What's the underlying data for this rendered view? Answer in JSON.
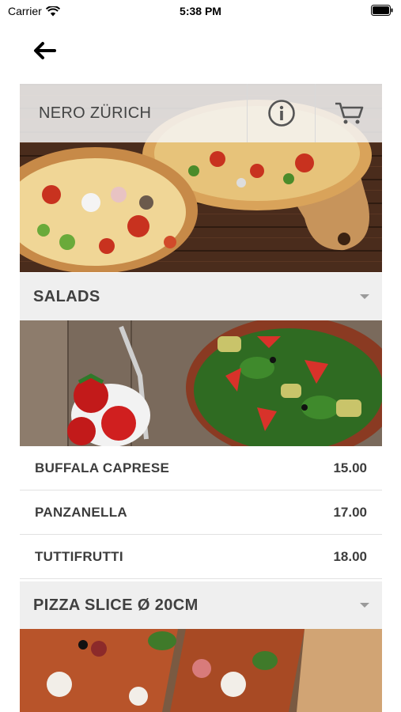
{
  "status": {
    "carrier": "Carrier",
    "time": "5:38 PM"
  },
  "header": {
    "restaurant_name": "NERO ZÜRICH",
    "info_icon": "info-icon",
    "cart_icon": "cart-icon",
    "back_icon": "arrow-left-icon"
  },
  "sections": [
    {
      "title": "SALADS",
      "items": [
        {
          "name": "BUFFALA CAPRESE",
          "price": "15.00"
        },
        {
          "name": "PANZANELLA",
          "price": "17.00"
        },
        {
          "name": "TUTTIFRUTTI",
          "price": "18.00"
        }
      ]
    },
    {
      "title": "PIZZA SLICE Ø 20CM"
    }
  ],
  "colors": {
    "section_bg": "#efefef",
    "header_overlay": "#f5f5f5",
    "text": "#3c3c3c"
  }
}
